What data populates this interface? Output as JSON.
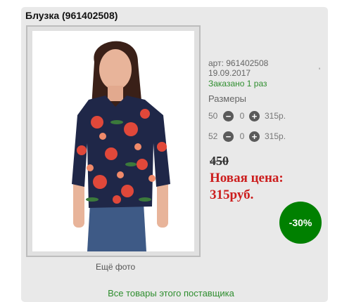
{
  "product": {
    "title": "Блузка (961402508)",
    "more_photo_label": "Ещё фото",
    "article_label": "арт: 961402508",
    "date": "19.09.2017",
    "ordered_text": "Заказано 1 раз",
    "tick_mark": "'",
    "sizes_label": "Размеры",
    "sizes": [
      {
        "size": "50",
        "minus_icon": "minus-circle-icon",
        "qty": "0",
        "plus_icon": "plus-circle-icon",
        "price": "315р."
      },
      {
        "size": "52",
        "minus_icon": "minus-circle-icon",
        "qty": "0",
        "plus_icon": "plus-circle-icon",
        "price": "315р."
      }
    ],
    "old_price": "450",
    "new_price_label": "Новая цена:",
    "new_price_value": "315руб.",
    "discount_badge": "-30%",
    "supplier_link": "Все товары этого поставщика"
  },
  "colors": {
    "accent_green": "#008000",
    "link_green": "#2f8e2f",
    "sale_red": "#cc1e1e",
    "card_bg": "#e9e9e9"
  }
}
